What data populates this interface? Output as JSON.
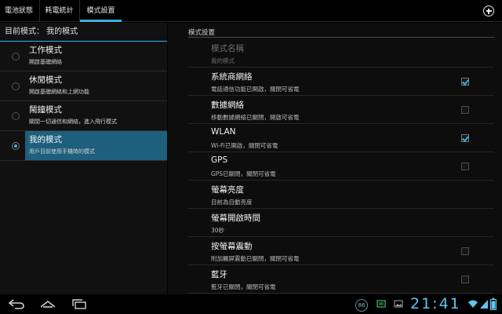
{
  "tabs": [
    {
      "label": "電池狀態"
    },
    {
      "label": "耗電統計"
    },
    {
      "label": "模式設置"
    }
  ],
  "left": {
    "header": "目前模式： 我的模式",
    "modes": [
      {
        "title": "工作模式",
        "subtitle": "開啟基礎網絡"
      },
      {
        "title": "休閒模式",
        "subtitle": "開啟基礎網絡和上網功能"
      },
      {
        "title": "鬧鐘模式",
        "subtitle": "關閉一切通信和網絡，進入飛行模式"
      },
      {
        "title": "我的模式",
        "subtitle": "用戶目前使用手機時的模式"
      }
    ],
    "selected_index": 3
  },
  "right": {
    "section": "模式設置",
    "prefs": [
      {
        "title": "模式名稱",
        "subtitle": "我的模式",
        "disabled": true,
        "checkbox": null
      },
      {
        "title": "系統商網絡",
        "subtitle": "電話通信功能已開啟，關閉可省電",
        "checkbox": true
      },
      {
        "title": "數據網絡",
        "subtitle": "移動數據網絡已關閉，開啟可省電",
        "checkbox": false
      },
      {
        "title": "WLAN",
        "subtitle": "Wi-Fi已開啟，關閉可省電",
        "checkbox": true
      },
      {
        "title": "GPS",
        "subtitle": "GPS已關閉，關閉可省電",
        "checkbox": false
      },
      {
        "title": "螢幕亮度",
        "subtitle": "目前為自動亮度",
        "checkbox": null
      },
      {
        "title": "螢幕開啟時間",
        "subtitle": "30秒",
        "checkbox": null
      },
      {
        "title": "按螢幕震動",
        "subtitle": "附加觸屏震動已關閉，關閉可省電",
        "checkbox": false
      },
      {
        "title": "藍牙",
        "subtitle": "藍牙已關閉，關閉可省電",
        "checkbox": false
      }
    ]
  },
  "statusbar": {
    "badge": "86",
    "time": "21:41"
  },
  "colors": {
    "accent": "#33b5e5",
    "selected_row": "#1d5f7d",
    "time_text": "#5ec7ee"
  },
  "icons": [
    "add-icon",
    "back-icon",
    "home-icon",
    "recent-apps-icon",
    "battery-saver-icon",
    "image-icon",
    "wifi-icon",
    "signal-icon",
    "battery-icon"
  ]
}
